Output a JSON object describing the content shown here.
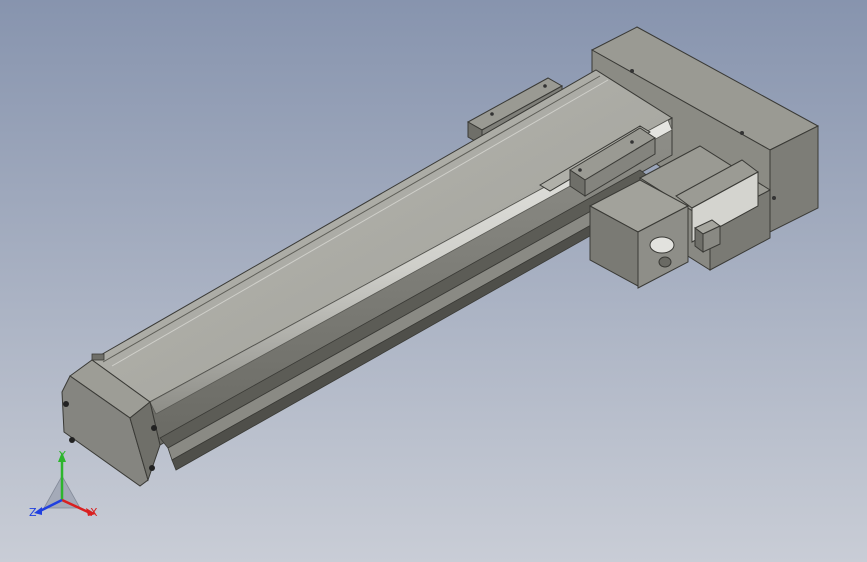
{
  "viewport": {
    "background_top": "#8794ae",
    "background_bottom": "#c9cdd6"
  },
  "model": {
    "name": "linear-actuator-module",
    "body_color": "#a7a7a0",
    "dark_color": "#6f6f69",
    "end_block_color": "#858580"
  },
  "triad": {
    "y_label": "Y",
    "x_label": "X",
    "z_label": "Z",
    "y_color": "#2db52d",
    "x_color": "#d92020",
    "z_color": "#2040e0"
  }
}
